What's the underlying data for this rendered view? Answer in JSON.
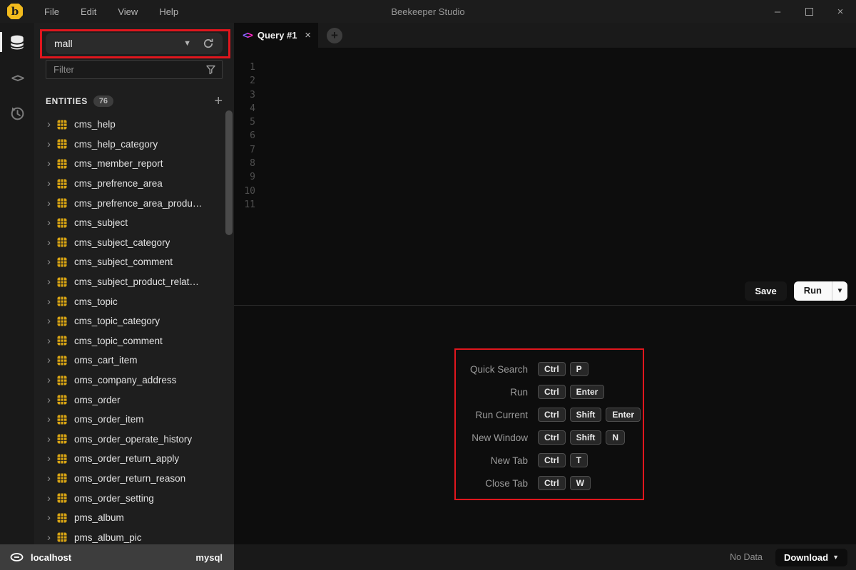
{
  "window": {
    "title": "Beekeeper Studio",
    "logo_letter": "b",
    "menus": [
      "File",
      "Edit",
      "View",
      "Help"
    ],
    "controls": {
      "minimize": "–",
      "close": "×"
    }
  },
  "sidebar": {
    "database_select": {
      "value": "mall"
    },
    "filter_placeholder": "Filter",
    "entities_label": "ENTITIES",
    "entities_count": "76",
    "entities": [
      "cms_help",
      "cms_help_category",
      "cms_member_report",
      "cms_prefrence_area",
      "cms_prefrence_area_produ…",
      "cms_subject",
      "cms_subject_category",
      "cms_subject_comment",
      "cms_subject_product_relat…",
      "cms_topic",
      "cms_topic_category",
      "cms_topic_comment",
      "oms_cart_item",
      "oms_company_address",
      "oms_order",
      "oms_order_item",
      "oms_order_operate_history",
      "oms_order_return_apply",
      "oms_order_return_reason",
      "oms_order_setting",
      "pms_album",
      "pms_album_pic"
    ]
  },
  "editor": {
    "tab_label": "Query #1",
    "tab_icon": {
      "left": "<",
      "right": ">"
    },
    "line_numbers": [
      "1",
      "2",
      "3",
      "4",
      "5",
      "6",
      "7",
      "8",
      "9",
      "10",
      "11"
    ],
    "save_label": "Save",
    "run_label": "Run"
  },
  "shortcuts": [
    {
      "label": "Quick Search",
      "keys": [
        "Ctrl",
        "P"
      ]
    },
    {
      "label": "Run",
      "keys": [
        "Ctrl",
        "Enter"
      ]
    },
    {
      "label": "Run Current",
      "keys": [
        "Ctrl",
        "Shift",
        "Enter"
      ]
    },
    {
      "label": "New Window",
      "keys": [
        "Ctrl",
        "Shift",
        "N"
      ]
    },
    {
      "label": "New Tab",
      "keys": [
        "Ctrl",
        "T"
      ]
    },
    {
      "label": "Close Tab",
      "keys": [
        "Ctrl",
        "W"
      ]
    }
  ],
  "statusbar": {
    "host": "localhost",
    "driver": "mysql",
    "result_status": "No Data",
    "download_label": "Download"
  },
  "colors": {
    "annotation_red": "#e0161d",
    "brand_yellow": "#f2bb1d",
    "table_icon_yellow": "#d9a514",
    "tab_icon_left": "#8a63ff",
    "tab_icon_right": "#ff27c7"
  }
}
